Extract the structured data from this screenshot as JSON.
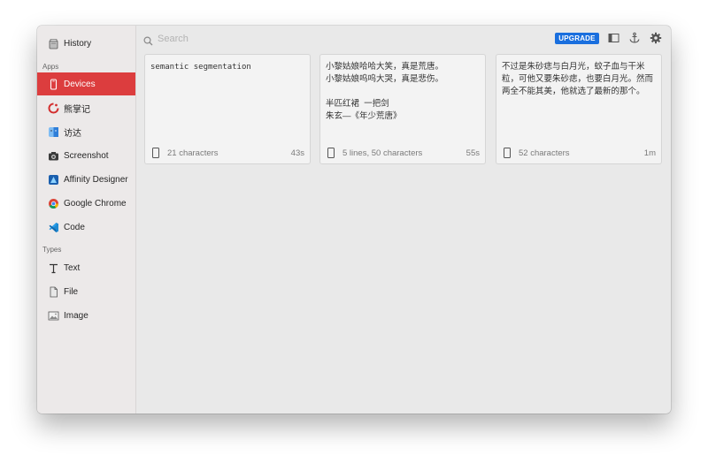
{
  "sidebar": {
    "history": {
      "label": "History",
      "icon": "history-icon"
    },
    "apps_heading": "Apps",
    "apps": [
      {
        "label": "Devices",
        "icon": "devices-icon",
        "active": true
      },
      {
        "label": "熊掌记",
        "icon": "bear-app-icon"
      },
      {
        "label": "访达",
        "icon": "finder-app-icon"
      },
      {
        "label": "Screenshot",
        "icon": "camera-icon"
      },
      {
        "label": "Affinity Designer",
        "icon": "affinity-designer-icon"
      },
      {
        "label": "Google Chrome",
        "icon": "chrome-icon"
      },
      {
        "label": "Code",
        "icon": "vscode-icon"
      }
    ],
    "types_heading": "Types",
    "types": [
      {
        "label": "Text",
        "icon": "text-type-icon"
      },
      {
        "label": "File",
        "icon": "file-icon"
      },
      {
        "label": "Image",
        "icon": "image-icon"
      }
    ]
  },
  "toolbar": {
    "search_placeholder": "Search",
    "upgrade_label": "UPGRADE"
  },
  "colors": {
    "accent_red": "#dc3d3e",
    "upgrade_blue": "#1a6fde"
  },
  "clips": [
    {
      "content": "semantic segmentation",
      "meta": "21 characters",
      "time": "43s"
    },
    {
      "content": "小黎姑娘哈哈大笑，真是荒唐。\n小黎姑娘呜呜大哭，真是悲伤。\n\n半匹红裙  一把剑\n朱玄—《年少荒唐》",
      "meta": "5 lines, 50 characters",
      "time": "55s"
    },
    {
      "content": "不过是朱砂痣与白月光，蚊子血与干米粒，可他又要朱砂痣，也要白月光。然而两全不能其美，他就选了最新的那个。",
      "meta": "52 characters",
      "time": "1m"
    }
  ]
}
